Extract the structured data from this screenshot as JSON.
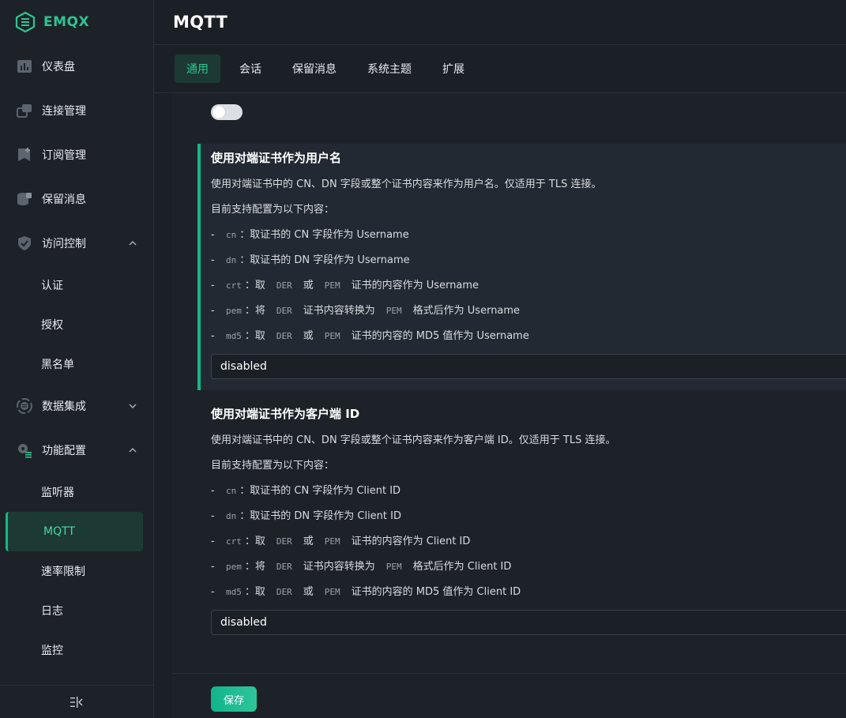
{
  "brand": {
    "name": "EMQX",
    "color": "#2fc391"
  },
  "sidebar": {
    "items": [
      {
        "label": "仪表盘",
        "icon": "dashboard-icon"
      },
      {
        "label": "连接管理",
        "icon": "connections-icon"
      },
      {
        "label": "订阅管理",
        "icon": "subscriptions-icon"
      },
      {
        "label": "保留消息",
        "icon": "retained-icon"
      },
      {
        "label": "访问控制",
        "icon": "shield-icon",
        "expanded": true,
        "children": [
          {
            "label": "认证"
          },
          {
            "label": "授权"
          },
          {
            "label": "黑名单"
          }
        ]
      },
      {
        "label": "数据集成",
        "icon": "integration-icon",
        "expanded": false
      },
      {
        "label": "功能配置",
        "icon": "settings-icon",
        "expanded": true,
        "children": [
          {
            "label": "监听器"
          },
          {
            "label": "MQTT",
            "active": true
          },
          {
            "label": "速率限制"
          },
          {
            "label": "日志"
          },
          {
            "label": "监控"
          }
        ]
      }
    ],
    "collapse_icon": "collapse-sidebar-icon"
  },
  "header": {
    "title": "MQTT"
  },
  "tabs": [
    {
      "label": "通用",
      "active": true
    },
    {
      "label": "会话"
    },
    {
      "label": "保留消息"
    },
    {
      "label": "系统主题"
    },
    {
      "label": "扩展"
    }
  ],
  "toggle": {
    "on": false
  },
  "sections": [
    {
      "title": "使用对端证书作为用户名",
      "desc": "使用对端证书中的 CN、DN 字段或整个证书内容来作为用户名。仅适用于 TLS 连接。",
      "support": "目前支持配置为以下内容：",
      "options": [
        {
          "dash": "-",
          "code": "cn",
          "text": "：取证书的 CN 字段作为 Username"
        },
        {
          "dash": "-",
          "code": "dn",
          "text": "：取证书的 DN 字段作为 Username"
        },
        {
          "dash": "-",
          "code": "crt",
          "p1": "：取",
          "c1": "DER",
          "p2": "或",
          "c2": "PEM",
          "p3": "证书的内容作为 Username"
        },
        {
          "dash": "-",
          "code": "pem",
          "p1": "：将",
          "c1": "DER",
          "p2": "证书内容转换为",
          "c2": "PEM",
          "p3": "格式后作为 Username"
        },
        {
          "dash": "-",
          "code": "md5",
          "p1": "：取",
          "c1": "DER",
          "p2": "或",
          "c2": "PEM",
          "p3": "证书的内容的 MD5 值作为 Username"
        }
      ],
      "value": "disabled"
    },
    {
      "title": "使用对端证书作为客户端 ID",
      "desc": "使用对端证书中的 CN、DN 字段或整个证书内容来作为客户端 ID。仅适用于 TLS 连接。",
      "support": "目前支持配置为以下内容：",
      "options": [
        {
          "dash": "-",
          "code": "cn",
          "text": "：取证书的 CN 字段作为 Client ID"
        },
        {
          "dash": "-",
          "code": "dn",
          "text": "：取证书的 DN 字段作为 Client ID"
        },
        {
          "dash": "-",
          "code": "crt",
          "p1": "：取",
          "c1": "DER",
          "p2": "或",
          "c2": "PEM",
          "p3": "证书的内容作为 Client ID"
        },
        {
          "dash": "-",
          "code": "pem",
          "p1": "：将",
          "c1": "DER",
          "p2": "证书内容转换为",
          "c2": "PEM",
          "p3": "格式后作为 Client ID"
        },
        {
          "dash": "-",
          "code": "md5",
          "p1": "：取",
          "c1": "DER",
          "p2": "或",
          "c2": "PEM",
          "p3": "证书的内容的 MD5 值作为 Client ID"
        }
      ],
      "value": "disabled"
    }
  ],
  "footer": {
    "save_label": "保存"
  },
  "colors": {
    "accent": "#12b886",
    "background": "#1b2027",
    "panel": "#1d2229"
  }
}
